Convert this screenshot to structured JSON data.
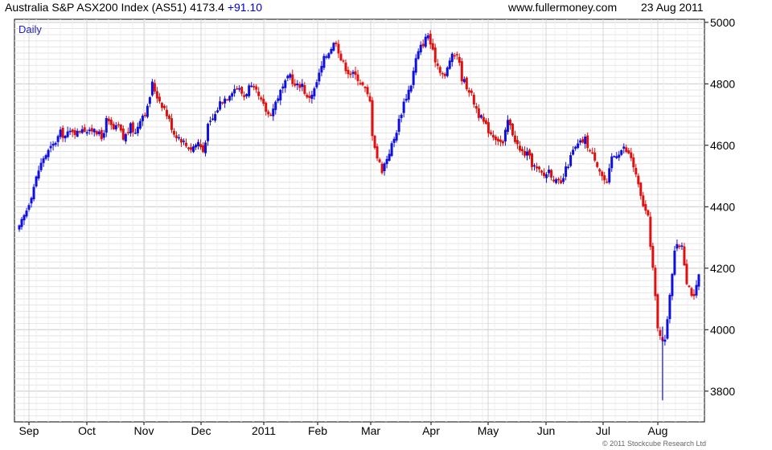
{
  "header": {
    "title": "Australia S&P ASX200 Index (AS51)",
    "last": "4173.4",
    "change": "+91.10",
    "site": "www.fullermoney.com",
    "date": "23 Aug 2011"
  },
  "copyright": "© 2011 Stockcube Research Ltd",
  "colors": {
    "up": "#1010dd",
    "down": "#e01010",
    "grid": "#e4e4e4",
    "axis": "#000000"
  },
  "chart_data": {
    "type": "candlestick",
    "period_label": "Daily",
    "ylim": [
      3700,
      5010
    ],
    "y_ticks": [
      3800,
      4000,
      4200,
      4400,
      4600,
      4800,
      5000
    ],
    "grid": true,
    "x_labels": [
      "Sep",
      "Oct",
      "Nov",
      "Dec",
      "2011",
      "Feb",
      "Mar",
      "Apr",
      "May",
      "Jun",
      "Jul",
      "Aug"
    ],
    "series": [
      {
        "close_path": [
          [
            0,
            4330
          ],
          [
            3,
            4390
          ],
          [
            5,
            4440
          ],
          [
            8,
            4520
          ],
          [
            10,
            4560
          ],
          [
            12,
            4580
          ],
          [
            14,
            4600
          ],
          [
            17,
            4640
          ],
          [
            19,
            4630
          ],
          [
            22,
            4650
          ],
          [
            24,
            4640
          ],
          [
            26,
            4660
          ],
          [
            29,
            4640
          ],
          [
            31,
            4660
          ],
          [
            34,
            4620
          ],
          [
            36,
            4680
          ],
          [
            39,
            4650
          ],
          [
            41,
            4660
          ],
          [
            43,
            4620
          ],
          [
            46,
            4660
          ],
          [
            48,
            4640
          ],
          [
            50,
            4690
          ],
          [
            53,
            4720
          ],
          [
            55,
            4800
          ],
          [
            57,
            4760
          ],
          [
            60,
            4720
          ],
          [
            62,
            4680
          ],
          [
            64,
            4640
          ],
          [
            67,
            4620
          ],
          [
            69,
            4600
          ],
          [
            71,
            4590
          ],
          [
            74,
            4610
          ],
          [
            76,
            4580
          ],
          [
            78,
            4660
          ],
          [
            81,
            4700
          ],
          [
            83,
            4740
          ],
          [
            86,
            4760
          ],
          [
            88,
            4780
          ],
          [
            90,
            4790
          ],
          [
            93,
            4760
          ],
          [
            95,
            4790
          ],
          [
            98,
            4770
          ],
          [
            100,
            4740
          ],
          [
            103,
            4700
          ],
          [
            105,
            4720
          ],
          [
            107,
            4760
          ],
          [
            110,
            4800
          ],
          [
            112,
            4830
          ],
          [
            114,
            4790
          ],
          [
            117,
            4800
          ],
          [
            119,
            4750
          ],
          [
            122,
            4780
          ],
          [
            124,
            4830
          ],
          [
            126,
            4880
          ],
          [
            129,
            4920
          ],
          [
            131,
            4940
          ],
          [
            133,
            4880
          ],
          [
            136,
            4840
          ],
          [
            138,
            4830
          ],
          [
            140,
            4820
          ],
          [
            143,
            4780
          ],
          [
            145,
            4740
          ],
          [
            146,
            4640
          ],
          [
            148,
            4560
          ],
          [
            150,
            4520
          ],
          [
            152,
            4560
          ],
          [
            155,
            4620
          ],
          [
            157,
            4680
          ],
          [
            159,
            4740
          ],
          [
            162,
            4800
          ],
          [
            164,
            4880
          ],
          [
            166,
            4920
          ],
          [
            169,
            4960
          ],
          [
            171,
            4900
          ],
          [
            173,
            4860
          ],
          [
            176,
            4820
          ],
          [
            178,
            4880
          ],
          [
            181,
            4900
          ],
          [
            183,
            4820
          ],
          [
            186,
            4780
          ],
          [
            188,
            4740
          ],
          [
            190,
            4700
          ],
          [
            193,
            4660
          ],
          [
            195,
            4640
          ],
          [
            198,
            4620
          ],
          [
            200,
            4600
          ],
          [
            202,
            4680
          ],
          [
            205,
            4620
          ],
          [
            207,
            4580
          ],
          [
            210,
            4570
          ],
          [
            212,
            4540
          ],
          [
            214,
            4520
          ],
          [
            217,
            4500
          ],
          [
            219,
            4520
          ],
          [
            222,
            4480
          ],
          [
            224,
            4470
          ],
          [
            226,
            4520
          ],
          [
            229,
            4580
          ],
          [
            231,
            4600
          ],
          [
            234,
            4620
          ],
          [
            236,
            4580
          ],
          [
            238,
            4560
          ],
          [
            241,
            4500
          ],
          [
            243,
            4470
          ],
          [
            245,
            4560
          ],
          [
            248,
            4580
          ],
          [
            250,
            4590
          ],
          [
            253,
            4560
          ],
          [
            255,
            4500
          ],
          [
            257,
            4430
          ],
          [
            260,
            4360
          ],
          [
            262,
            4200
          ],
          [
            264,
            4000
          ],
          [
            267,
            3960
          ],
          [
            269,
            4120
          ],
          [
            271,
            4260
          ],
          [
            274,
            4280
          ],
          [
            276,
            4160
          ],
          [
            279,
            4100
          ],
          [
            281,
            4173.4
          ]
        ],
        "spike": {
          "day": 266,
          "low": 3770
        }
      }
    ]
  }
}
